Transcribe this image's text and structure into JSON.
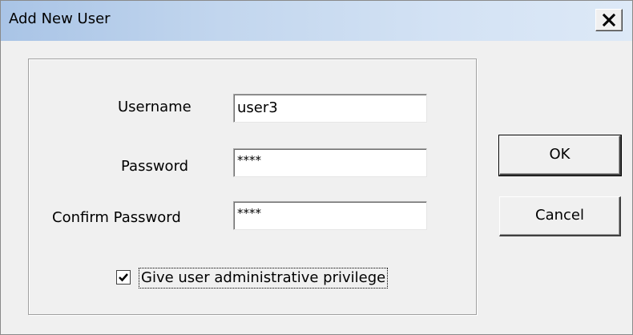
{
  "dialog": {
    "title": "Add New User",
    "close_icon": "close-icon"
  },
  "form": {
    "username_label": "Username",
    "username_value": "user3",
    "password_label": "Password",
    "password_value": "****",
    "confirm_label": "Confirm Password",
    "confirm_value": "****",
    "admin_checkbox_label": "Give user administrative privilege",
    "admin_checked": true
  },
  "buttons": {
    "ok_label": "OK",
    "cancel_label": "Cancel"
  },
  "colors": {
    "titlebar_start": "#a9c4e6",
    "titlebar_end": "#dde9f7",
    "dialog_face": "#f0f0f0"
  }
}
